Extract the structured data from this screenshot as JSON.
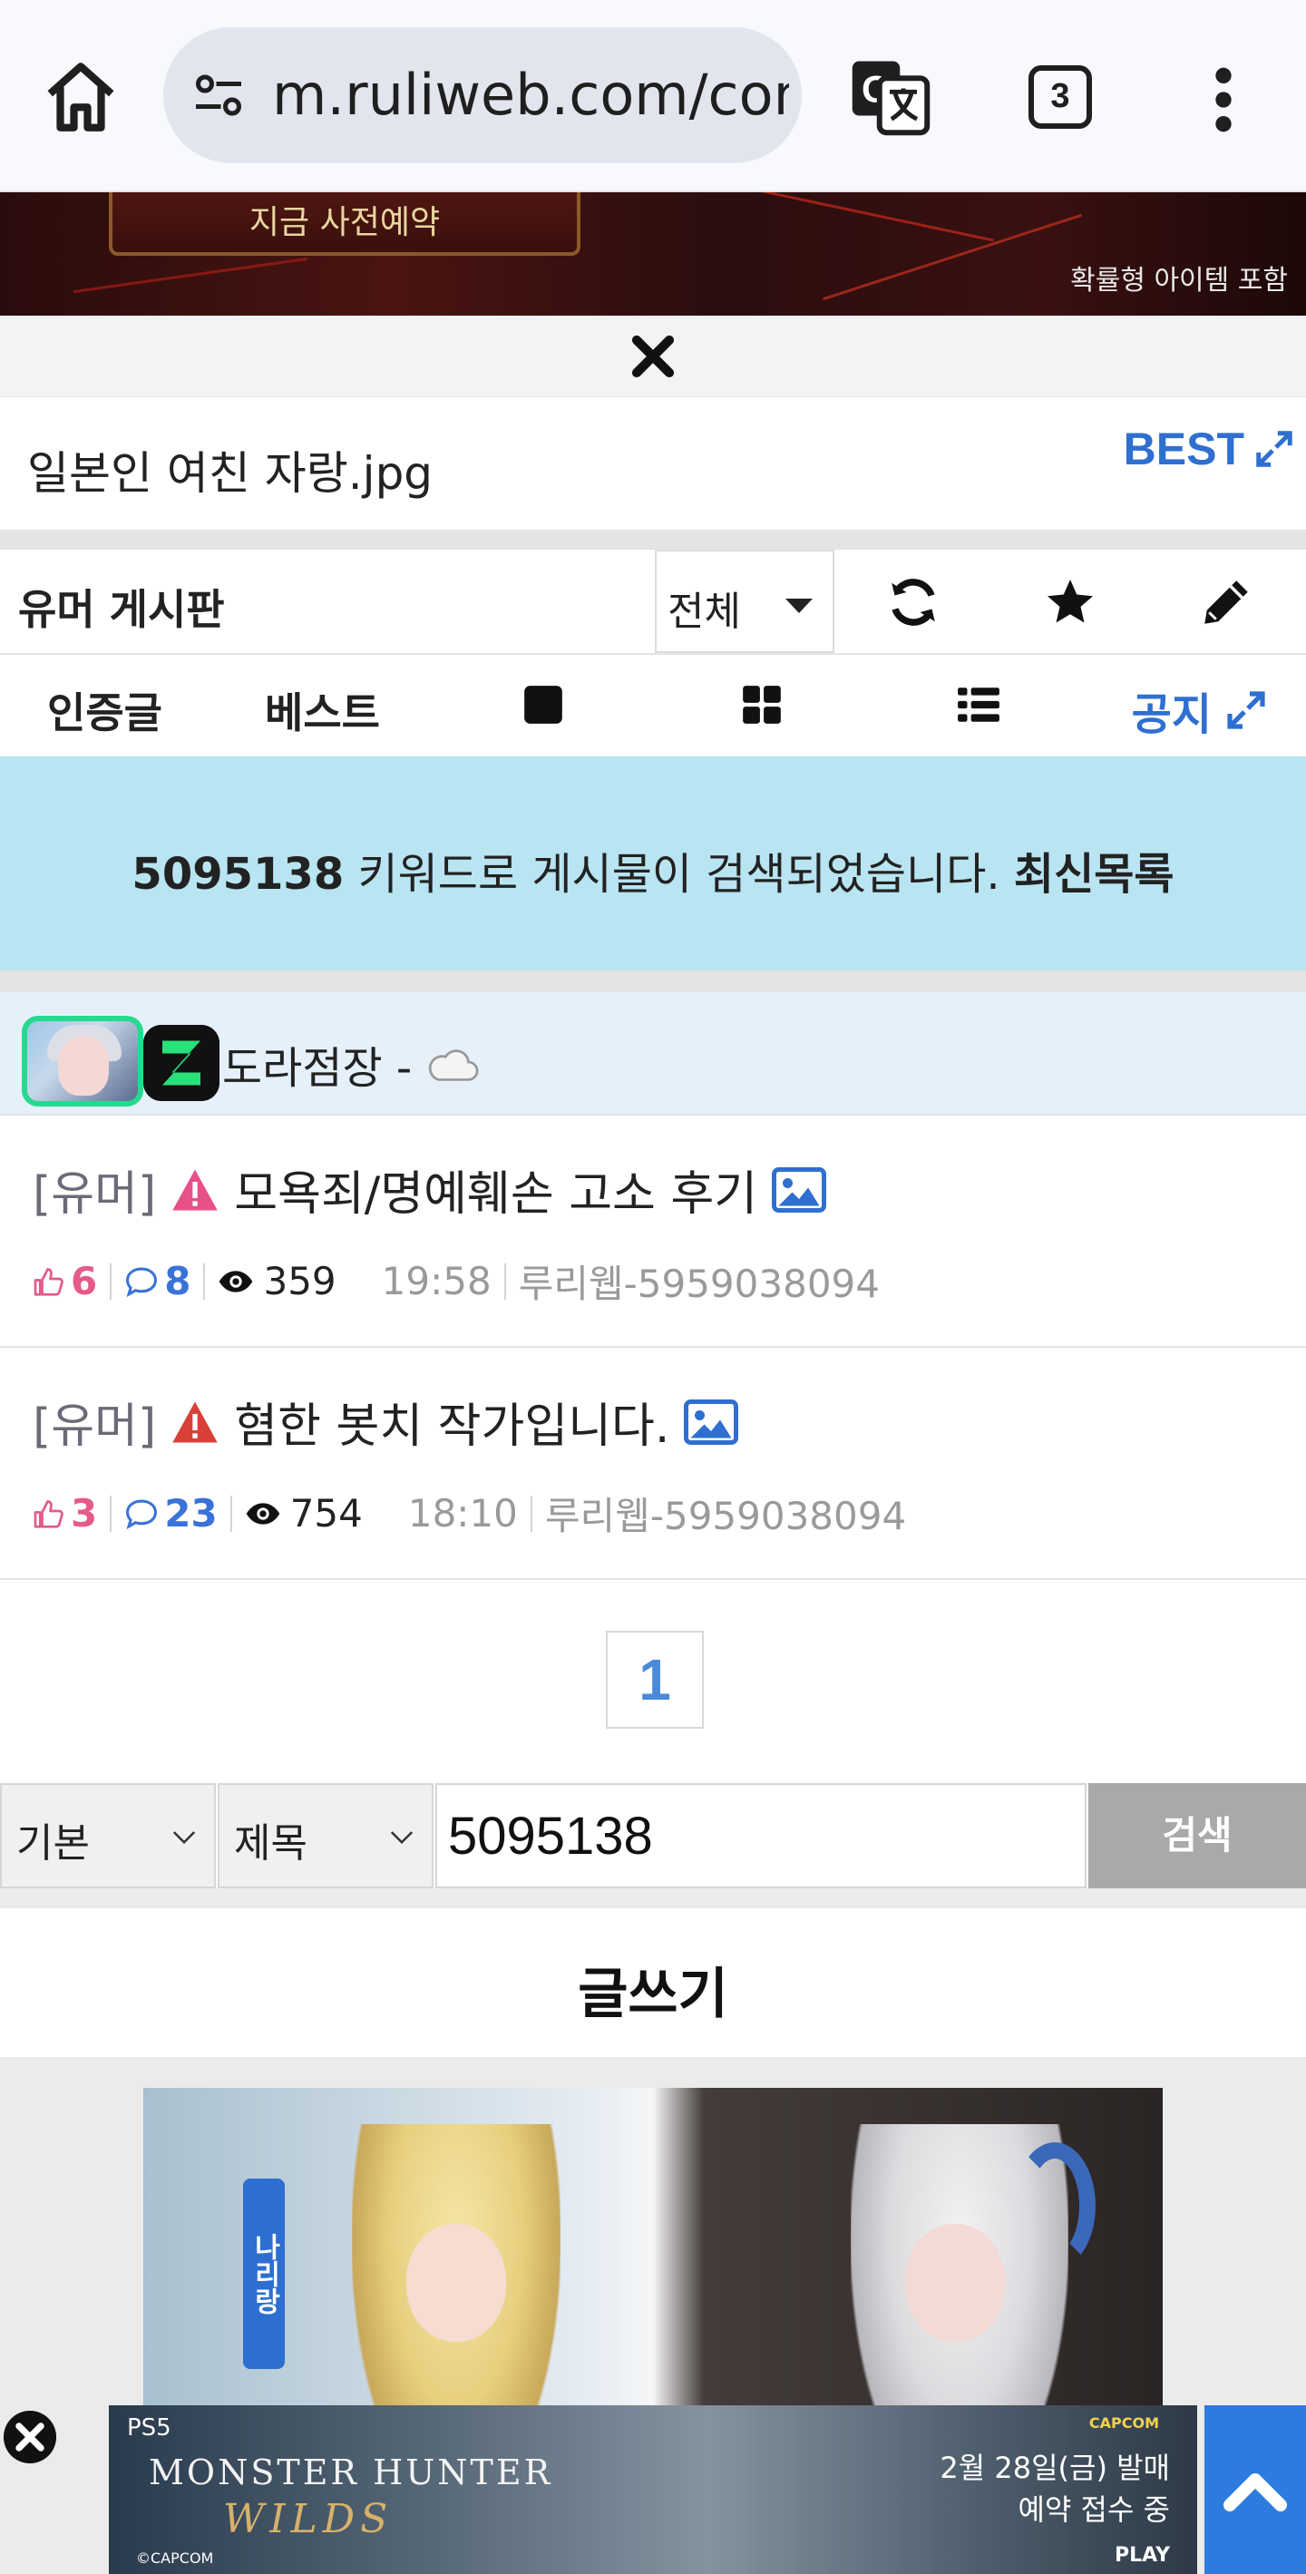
{
  "browser": {
    "url": "m.ruliweb.com/com",
    "tab_count": "3"
  },
  "top_banner": {
    "plate_text": "지금 사전예약",
    "note": "확률형 아이템 포함"
  },
  "post": {
    "title": "일본인 여친 자랑.jpg",
    "best_label": "BEST"
  },
  "board": {
    "name": "유머 게시판",
    "filter_value": "전체"
  },
  "tabs": {
    "verified": "인증글",
    "best": "베스트",
    "notice": "공지"
  },
  "search_info": {
    "keyword": "5095138",
    "message": " 키워드로 게시물이 검색되었습니다. ",
    "latest_link": "최신목록"
  },
  "user": {
    "name": "도라점장 -"
  },
  "posts": [
    {
      "category": "[유머]",
      "title": "모욕죄/명예훼손 고소 후기",
      "warning_color": "#e8508a",
      "likes": "6",
      "comments": "8",
      "views": "359",
      "time": "19:58",
      "author": "루리웹-5959038094"
    },
    {
      "category": "[유머]",
      "title": "혐한 봇치 작가입니다.",
      "warning_color": "#d8403a",
      "likes": "3",
      "comments": "23",
      "views": "754",
      "time": "18:10",
      "author": "루리웹-5959038094"
    }
  ],
  "pagination": {
    "current_page": "1"
  },
  "search": {
    "mode": "기본",
    "field": "제목",
    "query": "5095138",
    "button": "검색"
  },
  "write_label": "글쓰기",
  "ads": {
    "cosplay_tag": "나리랑",
    "mh_brand": "PS5",
    "mh_title": "MONSTER HUNTER",
    "mh_subtitle": "WILDS",
    "mh_date": "2월 28일(금) 발매",
    "mh_preorder": "예약 접수 중",
    "mh_play": "PLAY",
    "mh_capcom": "CAPCOM",
    "mh_copyright": "©CAPCOM"
  },
  "colors": {
    "accent_blue": "#2f6fd0",
    "search_info_bg": "#b9e4f2",
    "like_pink": "#e65a8a",
    "comment_blue": "#3a73d8"
  }
}
